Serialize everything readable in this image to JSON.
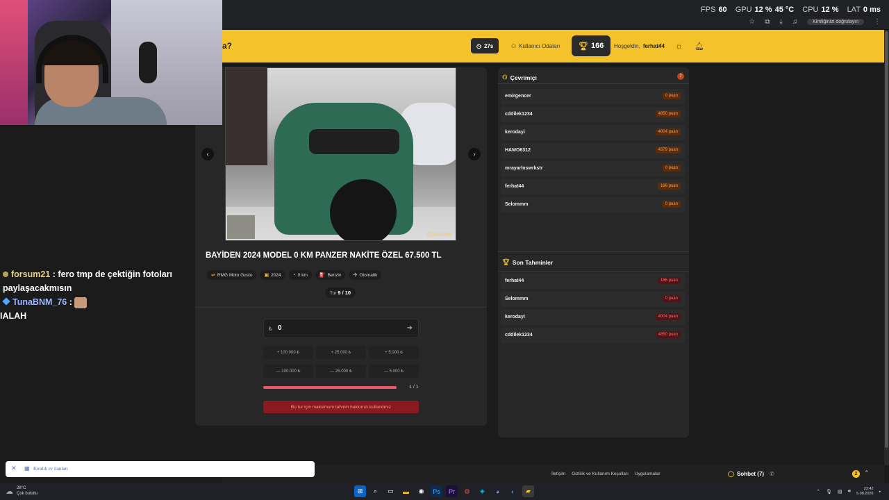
{
  "performance": {
    "fps_label": "FPS",
    "fps": "60",
    "gpu_label": "GPU",
    "gpu": "12 %",
    "gpu_temp": "45 °C",
    "cpu_label": "CPU",
    "cpu": "12 %",
    "lat_label": "LAT",
    "lat": "0 ms"
  },
  "browser": {
    "signin_label": "Kimliğinizi doğrulayın"
  },
  "header": {
    "brand_fragment": "a?",
    "timer": "27s",
    "rooms_label": "Kullanıcı Odaları",
    "trophy_count": "166",
    "welcome_prefix": "Hoşgeldin,",
    "username": "ferhat44"
  },
  "stream_chat": {
    "messages": [
      {
        "user": "forsum21",
        "text": ": fero tmp de çektiğin fotoları paylaşacakmısın"
      },
      {
        "user": "TunaBNM_76",
        "text": ":"
      },
      {
        "user": "",
        "text": "IALAH"
      }
    ]
  },
  "listing": {
    "watermark": "@arabam",
    "title": "BAYİDEN 2024 MODEL 0 KM PANZER NAKİTE ÖZEL 67.500 TL",
    "tags": [
      {
        "icon": "⇌",
        "label": "RMG Moto Gusto"
      },
      {
        "icon": "▣",
        "label": "2024"
      },
      {
        "icon": "◔",
        "label": "0 km"
      },
      {
        "icon": "⛽",
        "label": "Benzin"
      },
      {
        "icon": "✣",
        "label": "Otomatik"
      }
    ],
    "round_label": "Tur",
    "round_value": "9 / 10"
  },
  "guess": {
    "currency": "₺",
    "value": "0",
    "plus_buttons": [
      "+ 100.000 ₺",
      "+ 25.000 ₺",
      "+ 5.000 ₺"
    ],
    "minus_buttons": [
      "— 100.000 ₺",
      "— 25.000 ₺",
      "— 5.000 ₺"
    ],
    "attempts_used": 1,
    "attempts_total": 1,
    "attempts_text": "1 / 1",
    "limit_message": "Bu tur için maksimum tahmin hakkınızı kullandınız"
  },
  "online": {
    "title": "Çevrimiçi",
    "count": "7",
    "players": [
      {
        "name": "emirgencer",
        "points": "0 puan"
      },
      {
        "name": "cddilek1234",
        "points": "4850 puan"
      },
      {
        "name": "kerodayi",
        "points": "4004 puan"
      },
      {
        "name": "HAMO6312",
        "points": "4379 puan"
      },
      {
        "name": "mrayarlnswrkstr",
        "points": "0 puan"
      },
      {
        "name": "ferhat44",
        "points": "166 puan"
      },
      {
        "name": "Selommm",
        "points": "0 puan"
      }
    ]
  },
  "recent": {
    "title": "Son Tahminler",
    "guesses": [
      {
        "name": "ferhat44",
        "points": "166 puan"
      },
      {
        "name": "Selommm",
        "points": "0 puan"
      },
      {
        "name": "kerodayi",
        "points": "4004 puan"
      },
      {
        "name": "cddilek1234",
        "points": "4850 puan"
      }
    ]
  },
  "footer": {
    "links": [
      "İletişim",
      "Gizlilik ve Kullanım Koşulları",
      "Uygulamalar"
    ],
    "chat_label": "Sohbet (7)",
    "notif_count": "2"
  },
  "search_toast": {
    "text": "Kiralık ev ilanları"
  },
  "taskbar": {
    "temp": "28°C",
    "weather": "Çok bulutlu",
    "time": "23:42",
    "date": "5.08.2026"
  },
  "colors": {
    "accent": "#f4c22b",
    "danger": "#8a1a1f",
    "panel": "#272727",
    "background": "#1b1b1b"
  }
}
